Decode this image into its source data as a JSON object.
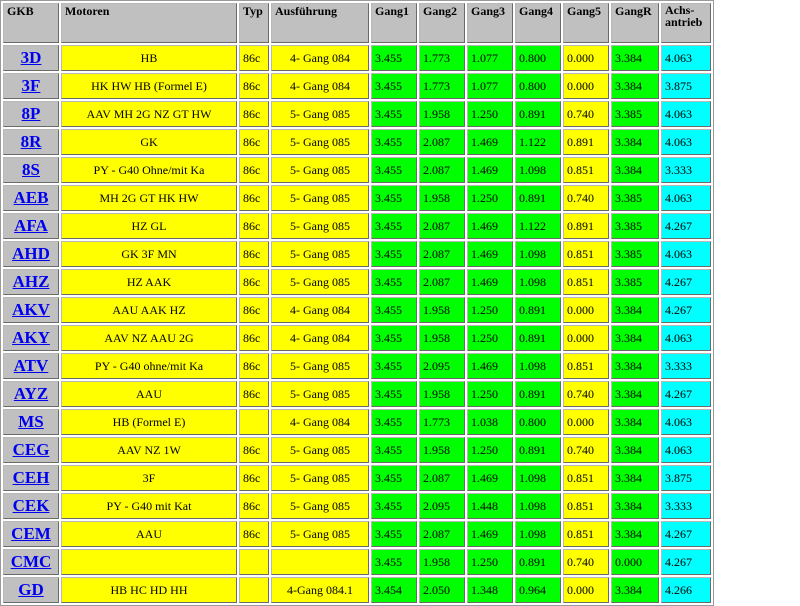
{
  "headers": [
    "GKB",
    "Motoren",
    "Typ",
    "Ausführung",
    "Gang1",
    "Gang2",
    "Gang3",
    "Gang4",
    "Gang5",
    "GangR",
    "Achs-antrieb"
  ],
  "rows": [
    {
      "code": "3D",
      "motoren": "HB",
      "typ": "86c",
      "ausfuehrung": "4- Gang 084",
      "g1": "3.455",
      "g2": "1.773",
      "g3": "1.077",
      "g4": "0.800",
      "g5": "0.000",
      "gr": "3.384",
      "achs": "4.063"
    },
    {
      "code": "3F",
      "motoren": "HK HW HB (Formel E)",
      "typ": "86c",
      "ausfuehrung": "4- Gang 084",
      "g1": "3.455",
      "g2": "1.773",
      "g3": "1.077",
      "g4": "0.800",
      "g5": "0.000",
      "gr": "3.384",
      "achs": "3.875"
    },
    {
      "code": "8P",
      "motoren": "AAV MH 2G NZ GT HW",
      "typ": "86c",
      "ausfuehrung": "5- Gang 085",
      "g1": "3.455",
      "g2": "1.958",
      "g3": "1.250",
      "g4": "0.891",
      "g5": "0.740",
      "gr": "3.385",
      "achs": "4.063"
    },
    {
      "code": "8R",
      "motoren": "GK",
      "typ": "86c",
      "ausfuehrung": "5- Gang 085",
      "g1": "3.455",
      "g2": "2.087",
      "g3": "1.469",
      "g4": "1.122",
      "g5": "0.891",
      "gr": "3.384",
      "achs": "4.063"
    },
    {
      "code": "8S",
      "motoren": "PY - G40 Ohne/mit Ka",
      "typ": "86c",
      "ausfuehrung": "5- Gang 085",
      "g1": "3.455",
      "g2": "2.087",
      "g3": "1.469",
      "g4": "1.098",
      "g5": "0.851",
      "gr": "3.384",
      "achs": "3.333"
    },
    {
      "code": "AEB",
      "motoren": "MH 2G GT HK HW",
      "typ": "86c",
      "ausfuehrung": "5- Gang 085",
      "g1": "3.455",
      "g2": "1.958",
      "g3": "1.250",
      "g4": "0.891",
      "g5": "0.740",
      "gr": "3.385",
      "achs": "4.063"
    },
    {
      "code": "AFA",
      "motoren": "HZ GL",
      "typ": "86c",
      "ausfuehrung": "5- Gang 085",
      "g1": "3.455",
      "g2": "2.087",
      "g3": "1.469",
      "g4": "1.122",
      "g5": "0.891",
      "gr": "3.385",
      "achs": "4.267"
    },
    {
      "code": "AHD",
      "motoren": "GK 3F MN",
      "typ": "86c",
      "ausfuehrung": "5- Gang 085",
      "g1": "3.455",
      "g2": "2.087",
      "g3": "1.469",
      "g4": "1.098",
      "g5": "0.851",
      "gr": "3.385",
      "achs": "4.063"
    },
    {
      "code": "AHZ",
      "motoren": "HZ AAK",
      "typ": "86c",
      "ausfuehrung": "5- Gang 085",
      "g1": "3.455",
      "g2": "2.087",
      "g3": "1.469",
      "g4": "1.098",
      "g5": "0.851",
      "gr": "3.385",
      "achs": "4.267"
    },
    {
      "code": "AKV",
      "motoren": "AAU AAK HZ",
      "typ": "86c",
      "ausfuehrung": "4- Gang 084",
      "g1": "3.455",
      "g2": "1.958",
      "g3": "1.250",
      "g4": "0.891",
      "g5": "0.000",
      "gr": "3.384",
      "achs": "4.267"
    },
    {
      "code": "AKY",
      "motoren": "AAV NZ AAU 2G",
      "typ": "86c",
      "ausfuehrung": "4- Gang 084",
      "g1": "3.455",
      "g2": "1.958",
      "g3": "1.250",
      "g4": "0.891",
      "g5": "0.000",
      "gr": "3.384",
      "achs": "4.063"
    },
    {
      "code": "ATV",
      "motoren": "PY - G40 ohne/mit Ka",
      "typ": "86c",
      "ausfuehrung": "5- Gang 085",
      "g1": "3.455",
      "g2": "2.095",
      "g3": "1.469",
      "g4": "1.098",
      "g5": "0.851",
      "gr": "3.384",
      "achs": "3.333"
    },
    {
      "code": "AYZ",
      "motoren": "AAU",
      "typ": "86c",
      "ausfuehrung": "5- Gang 085",
      "g1": "3.455",
      "g2": "1.958",
      "g3": "1.250",
      "g4": "0.891",
      "g5": "0.740",
      "gr": "3.384",
      "achs": "4.267"
    },
    {
      "code": "MS",
      "motoren": "HB (Formel E)",
      "typ": "",
      "ausfuehrung": "4- Gang 084",
      "g1": "3.455",
      "g2": "1.773",
      "g3": "1.038",
      "g4": "0.800",
      "g5": "0.000",
      "gr": "3.384",
      "achs": "4.063"
    },
    {
      "code": "CEG",
      "motoren": "AAV NZ 1W",
      "typ": "86c",
      "ausfuehrung": "5- Gang 085",
      "g1": "3.455",
      "g2": "1.958",
      "g3": "1.250",
      "g4": "0.891",
      "g5": "0.740",
      "gr": "3.384",
      "achs": "4.063"
    },
    {
      "code": "CEH",
      "motoren": "3F",
      "typ": "86c",
      "ausfuehrung": "5- Gang 085",
      "g1": "3.455",
      "g2": "2.087",
      "g3": "1.469",
      "g4": "1.098",
      "g5": "0.851",
      "gr": "3.384",
      "achs": "3.875"
    },
    {
      "code": "CEK",
      "motoren": "PY - G40 mit Kat",
      "typ": "86c",
      "ausfuehrung": "5- Gang 085",
      "g1": "3.455",
      "g2": "2.095",
      "g3": "1.448",
      "g4": "1.098",
      "g5": "0.851",
      "gr": "3.384",
      "achs": "3.333"
    },
    {
      "code": "CEM",
      "motoren": "AAU",
      "typ": "86c",
      "ausfuehrung": "5- Gang 085",
      "g1": "3.455",
      "g2": "2.087",
      "g3": "1.469",
      "g4": "1.098",
      "g5": "0.851",
      "gr": "3.384",
      "achs": "4.267"
    },
    {
      "code": "CMC",
      "motoren": "",
      "typ": "",
      "ausfuehrung": "",
      "g1": "3.455",
      "g2": "1.958",
      "g3": "1.250",
      "g4": "0.891",
      "g5": "0.740",
      "gr": "0.000",
      "achs": "4.267"
    },
    {
      "code": "GD",
      "motoren": "HB HC HD HH",
      "typ": "",
      "ausfuehrung": "4-Gang 084.1",
      "g1": "3.454",
      "g2": "2.050",
      "g3": "1.348",
      "g4": "0.964",
      "g5": "0.000",
      "gr": "3.384",
      "achs": "4.266"
    }
  ],
  "colors": {
    "header": "#c0c0c0",
    "yellow": "#ffff00",
    "green": "#00ff00",
    "cyan": "#00ffff",
    "link": "#0000ee"
  }
}
